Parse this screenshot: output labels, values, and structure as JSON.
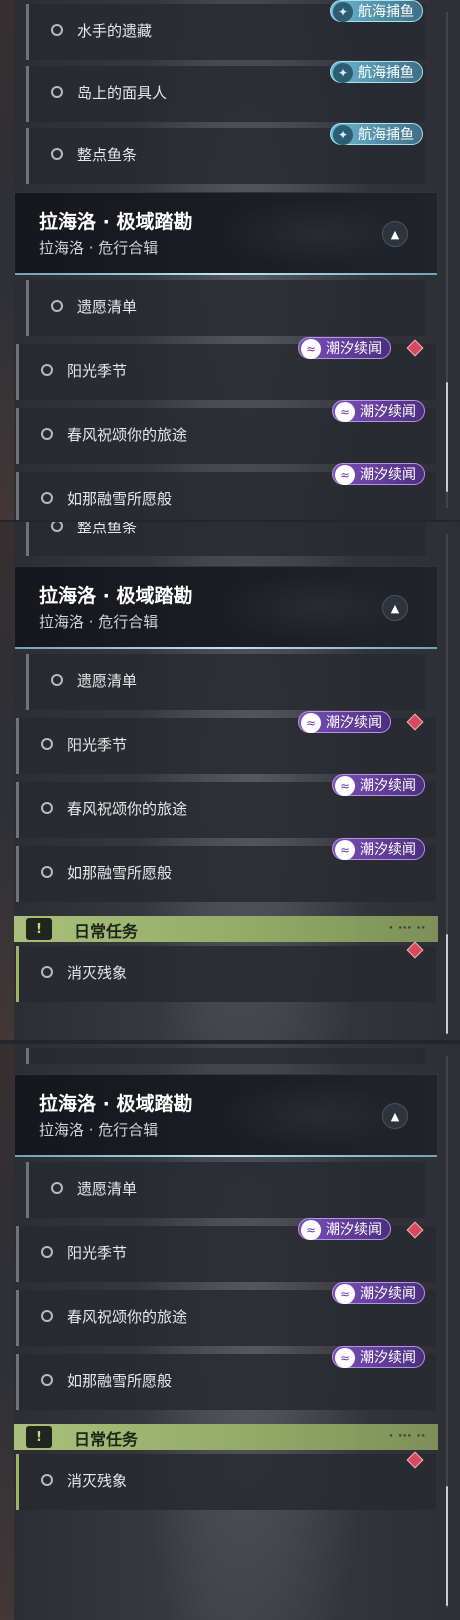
{
  "tags": {
    "voyage": "航海捕鱼",
    "tide": "潮汐续闻"
  },
  "chapter": {
    "title": "拉海洛 · 极域踏勘",
    "subtitle": "拉海洛 · 危行合辑"
  },
  "category": {
    "label": "日常任务",
    "icon_glyph": "!"
  },
  "quests": {
    "shui_shou": "水手的遗藏",
    "dao_shang": "岛上的面具人",
    "zheng_dian": "整点鱼条",
    "yi_yuan": "遗愿清单",
    "yang_guang": "阳光季节",
    "chun_feng": "春风祝颂你的旅途",
    "ru_na": "如那融雪所愿般",
    "xiao_mie": "消灭残象"
  },
  "icons": {
    "voyage_icon": "fish-icon",
    "tide_icon": "wave-icon",
    "collapse_icon": "chevron-up-icon",
    "marker_icon": "diamond-marker-icon",
    "quest_status_icon": "radio-circle-icon"
  },
  "colors": {
    "voyage_tag": "#6bb8d0",
    "tide_tag": "#7b4fb8",
    "marker": "#d64a5b",
    "daily_header": "#a8c07a"
  }
}
